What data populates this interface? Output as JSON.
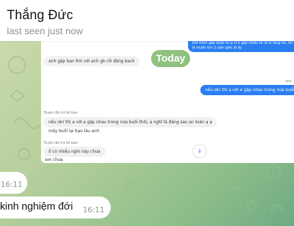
{
  "header": {
    "contact_name": "Thắng Đức",
    "status": "last seen just now"
  },
  "embedded_screenshot": {
    "top_outgoing": "Giờ mình gặp được ko ạ vì e gặp nhiều kh bị lo lắng nè, chỉ là muốn tìm 1 cảm giác là ấy",
    "incoming_1": "anh gặp bạn tìm với anh gb rồi đáng back",
    "outgoing_1_label": "unk",
    "outgoing_1": "nếu okr thì a với e gặp nhau trong nửa buổi thôi",
    "reply_1_hint": "Tuyên đã trả lời bạn",
    "incoming_2_line1": "nếu okr thì a với e gặp nhau trong nửa buổi thôi, ạ nghĩ là đáng sao an toàn ạ ạ",
    "incoming_2_line2": "mấy buổi lại bạo lâu anh",
    "reply_2_hint": "Tuyên đã trả lời bạn",
    "incoming_3": "ồ có nhiều nghi này chưa",
    "incoming_4": "em chưa",
    "scroll_icon": "arrow-down-icon"
  },
  "date_separator": "Today",
  "messages": [
    {
      "time": "16:11"
    },
    {
      "text": "kinh nghiệm đới",
      "time": "16:11"
    }
  ],
  "colors": {
    "header_bg": "#ffffff",
    "today_pill": "#8fc27f",
    "outgoing_bubble": "#2b7ef2",
    "incoming_bubble": "#ffffff"
  }
}
